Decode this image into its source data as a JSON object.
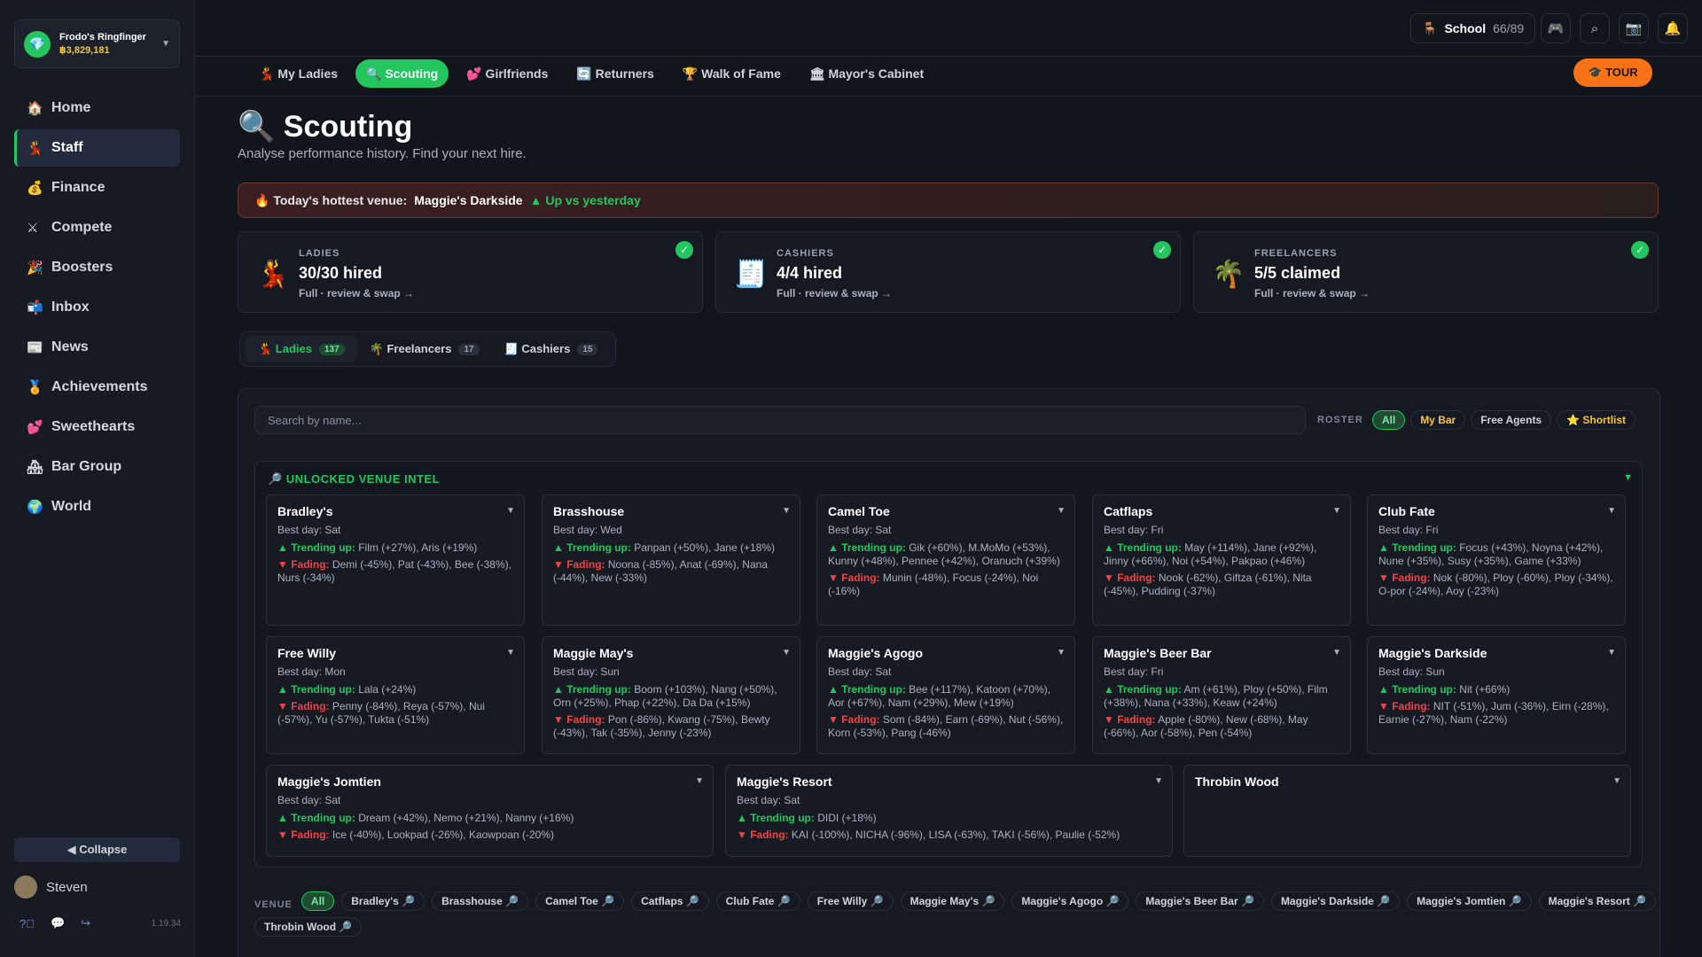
{
  "account": {
    "name": "Frodo's Ringfinger",
    "balance": "฿3,829,181"
  },
  "sidebar": {
    "items": [
      {
        "label": "Home",
        "icon": "🏠"
      },
      {
        "label": "Staff",
        "icon": "💃"
      },
      {
        "label": "Finance",
        "icon": "💰"
      },
      {
        "label": "Compete",
        "icon": "⚔"
      },
      {
        "label": "Boosters",
        "icon": "🎉"
      },
      {
        "label": "Inbox",
        "icon": "📬"
      },
      {
        "label": "News",
        "icon": "📰"
      },
      {
        "label": "Achievements",
        "icon": "🏅"
      },
      {
        "label": "Sweethearts",
        "icon": "💕"
      },
      {
        "label": "Bar Group",
        "icon": "🏘"
      },
      {
        "label": "World",
        "icon": "🌍"
      }
    ],
    "active": "Staff",
    "collapse": "◀ Collapse",
    "user": "Steven",
    "version": "1.19.34"
  },
  "topbar": {
    "school_label": "School",
    "school_count": "66/89"
  },
  "tabs": [
    "💃 My Ladies",
    "🔍 Scouting",
    "💕 Girlfriends",
    "🔄 Returners",
    "🏆 Walk of Fame",
    "🏛 Mayor's Cabinet"
  ],
  "tour": "🎓 TOUR",
  "page": {
    "title": "🔍 Scouting",
    "subtitle": "Analyse performance history. Find your next hire."
  },
  "banner": {
    "prefix": "🔥 Today's hottest venue:",
    "venue": "Maggie's Darkside",
    "status": "▲ Up vs yesterday"
  },
  "stats": [
    {
      "icon": "💃",
      "label": "LADIES",
      "value": "30/30 hired",
      "sub": "Full · review & swap →"
    },
    {
      "icon": "🧾",
      "label": "CASHIERS",
      "value": "4/4 hired",
      "sub": "Full · review & swap →"
    },
    {
      "icon": "🌴",
      "label": "FREELANCERS",
      "value": "5/5 claimed",
      "sub": "Full · review & swap →"
    }
  ],
  "roster_tabs": [
    {
      "label": "💃 Ladies",
      "count": "137"
    },
    {
      "label": "🌴 Freelancers",
      "count": "17"
    },
    {
      "label": "🧾 Cashiers",
      "count": "15"
    }
  ],
  "search": {
    "placeholder": "Search by name..."
  },
  "roster": {
    "label": "ROSTER",
    "options": [
      "All",
      "My Bar",
      "Free Agents",
      "⭐ Shortlist"
    ]
  },
  "intel": {
    "title": "🔎 UNLOCKED VENUE INTEL",
    "trend_label": "▲ Trending up:",
    "fade_label": "▼ Fading:",
    "venues": [
      {
        "name": "Bradley's",
        "best": "Best day: Sat",
        "up": "Film (+27%), Aris (+19%)",
        "down": "Demi (-45%), Pat (-43%), Bee (-38%), Nurs (-34%)"
      },
      {
        "name": "Brasshouse",
        "best": "Best day: Wed",
        "up": "Panpan (+50%), Jane (+18%)",
        "down": "Noona (-85%), Anat (-69%), Nana (-44%), New (-33%)"
      },
      {
        "name": "Camel Toe",
        "best": "Best day: Sat",
        "up": "Gik (+60%), M.MoMo (+53%), Kunny (+48%), Pennee (+42%), Oranuch (+39%)",
        "down": "Munin (-48%), Focus (-24%), Noi (-16%)"
      },
      {
        "name": "Catflaps",
        "best": "Best day: Fri",
        "up": "May (+114%), Jane (+92%), Jinny (+66%), Noi (+54%), Pakpao (+46%)",
        "down": "Nook (-62%), Giftza (-61%), Nita (-45%), Pudding (-37%)"
      },
      {
        "name": "Club Fate",
        "best": "Best day: Fri",
        "up": "Focus (+43%), Noyna (+42%), Nune (+35%), Susy (+35%), Game (+33%)",
        "down": "Nok (-80%), Ploy (-60%), Ploy (-34%), O-por (-24%), Aoy (-23%)"
      },
      {
        "name": "Free Willy",
        "best": "Best day: Mon",
        "up": "Lala (+24%)",
        "down": "Penny (-84%), Reya (-57%), Nui (-57%), Yu (-57%), Tukta (-51%)"
      },
      {
        "name": "Maggie May's",
        "best": "Best day: Sun",
        "up": "Boom (+103%), Nang (+50%), Orn (+25%), Phap (+22%), Da Da (+15%)",
        "down": "Pon (-86%), Kwang (-75%), Bewty (-43%), Tak (-35%), Jenny (-23%)"
      },
      {
        "name": "Maggie's Agogo",
        "best": "Best day: Sat",
        "up": "Bee (+117%), Katoon (+70%), Aor (+67%), Nam (+29%), Mew (+19%)",
        "down": "Som (-84%), Earn (-69%), Nut (-56%), Korn (-53%), Pang (-46%)"
      },
      {
        "name": "Maggie's Beer Bar",
        "best": "Best day: Fri",
        "up": "Am (+61%), Ploy (+50%), Film (+38%), Nana (+33%), Keaw (+24%)",
        "down": "Apple (-80%), New (-68%), May (-66%), Aor (-58%), Pen (-54%)"
      },
      {
        "name": "Maggie's Darkside",
        "best": "Best day: Sun",
        "up": "Nit (+66%)",
        "down": "NIT (-51%), Jum (-36%), Eirn (-28%), Earnie (-27%), Nam (-22%)"
      },
      {
        "name": "Maggie's Jomtien",
        "best": "Best day: Sat",
        "up": "Dream (+42%), Nemo (+21%), Nanny (+16%)",
        "down": "Ice (-40%), Lookpad (-26%), Kaowpoan (-20%)"
      },
      {
        "name": "Maggie's Resort",
        "best": "Best day: Sat",
        "up": "DIDI (+18%)",
        "down": "KAI (-100%), NICHA (-96%), LISA (-63%), TAKI (-56%), Paulie (-52%)"
      },
      {
        "name": "Throbin Wood",
        "best": "",
        "up": "",
        "down": ""
      }
    ]
  },
  "venue_filter": {
    "label": "VENUE",
    "chips": [
      "All",
      "Bradley's 🔎",
      "Brasshouse 🔎",
      "Camel Toe 🔎",
      "Catflaps 🔎",
      "Club Fate 🔎",
      "Free Willy 🔎",
      "Maggie May's 🔎",
      "Maggie's Agogo 🔎",
      "Maggie's Beer Bar 🔎",
      "Maggie's Darkside 🔎",
      "Maggie's Jomtien 🔎",
      "Maggie's Resort 🔎",
      "Throbin Wood 🔎"
    ]
  },
  "colors": {
    "accent": "#22c55e",
    "danger": "#ef4444",
    "tour": "#f97316",
    "balance": "#f5c542"
  }
}
